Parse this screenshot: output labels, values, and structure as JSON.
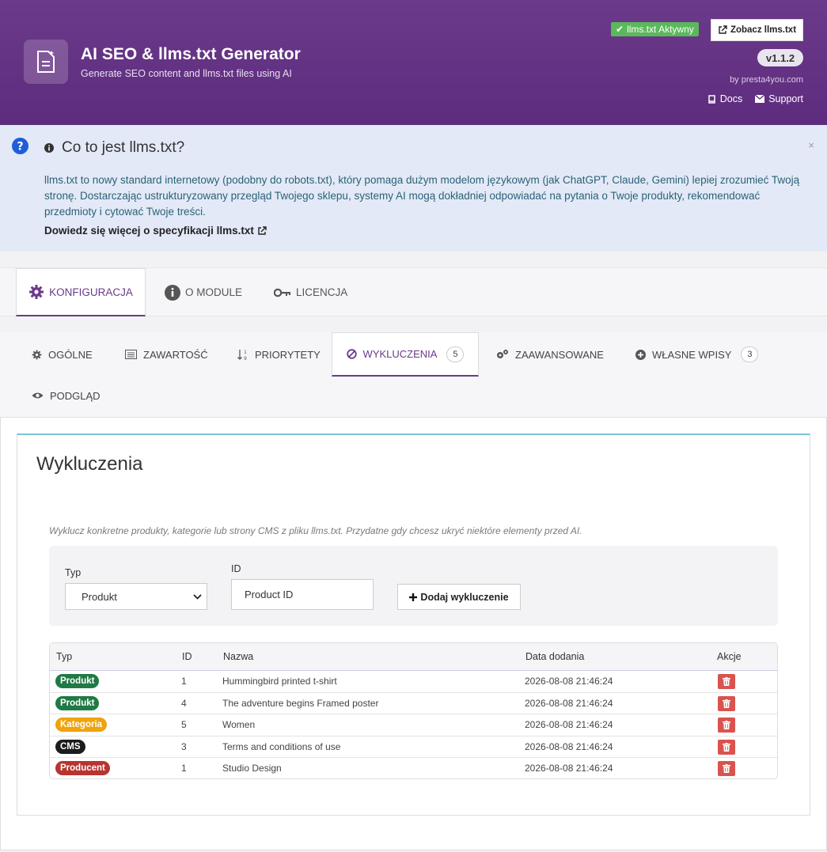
{
  "header": {
    "title": "AI SEO & llms.txt Generator",
    "subtitle": "Generate SEO content and llms.txt files using AI",
    "status_badge": "llms.txt Aktywny",
    "view_button": "Zobacz llms.txt",
    "version": "v1.1.2",
    "by": "by presta4you.com",
    "docs_label": "Docs",
    "support_label": "Support",
    "accent_color": "#6b3a8a"
  },
  "info": {
    "title": "Co to jest llms.txt?",
    "body": "llms.txt to nowy standard internetowy (podobny do robots.txt), który pomaga dużym modelom językowym (jak ChatGPT, Claude, Gemini) lepiej zrozumieć Twoją stronę. Dostarczając ustrukturyzowany przegląd Twojego sklepu, systemy AI mogą dokładniej odpowiadać na pytania o Twoje produkty, rekomendować przedmioty i cytować Twoje treści.",
    "link": "Dowiedz się więcej o specyfikacji llms.txt",
    "close": "×"
  },
  "main_tabs": [
    {
      "label": "Konfiguracja",
      "icon": "gear-icon"
    },
    {
      "label": "O module",
      "icon": "info-icon"
    },
    {
      "label": "Licencja",
      "icon": "key-icon"
    }
  ],
  "sub_tabs": [
    {
      "label": "Ogólne",
      "icon": "gear-icon"
    },
    {
      "label": "Zawartość",
      "icon": "list-icon"
    },
    {
      "label": "Priorytety",
      "icon": "sort-icon"
    },
    {
      "label": "Wykluczenia",
      "icon": "ban-icon",
      "count": "5"
    },
    {
      "label": "Zaawansowane",
      "icon": "gears-icon"
    },
    {
      "label": "Własne wpisy",
      "icon": "plus-circle-icon",
      "count": "3"
    },
    {
      "label": "Podgląd",
      "icon": "eye-icon"
    }
  ],
  "panel": {
    "title": "Wykluczenia",
    "description": "Wyklucz konkretne produkty, kategorie lub strony CMS z pliku llms.txt. Przydatne gdy chcesz ukryć niektóre elementy przed AI.",
    "form": {
      "type_label": "Typ",
      "type_value": "Produkt",
      "id_label": "ID",
      "id_placeholder": "Product ID",
      "add_button": "Dodaj wykluczenie"
    }
  },
  "table": {
    "headers": [
      "Typ",
      "ID",
      "Nazwa",
      "Data dodania",
      "Akcje"
    ],
    "rows": [
      {
        "type": "Produkt",
        "color": "#1f7a45",
        "id": "1",
        "name": "Hummingbird printed t-shirt",
        "date": "2026-08-08 21:46:24"
      },
      {
        "type": "Produkt",
        "color": "#1f7a45",
        "id": "4",
        "name": "The adventure begins Framed poster",
        "date": "2026-08-08 21:46:24"
      },
      {
        "type": "Kategoria",
        "color": "#f0a30a",
        "id": "5",
        "name": "Women",
        "date": "2026-08-08 21:46:24"
      },
      {
        "type": "CMS",
        "color": "#1c1c1c",
        "id": "3",
        "name": "Terms and conditions of use",
        "date": "2026-08-08 21:46:24"
      },
      {
        "type": "Producent",
        "color": "#b8342f",
        "id": "1",
        "name": "Studio Design",
        "date": "2026-08-08 21:46:24"
      }
    ]
  }
}
